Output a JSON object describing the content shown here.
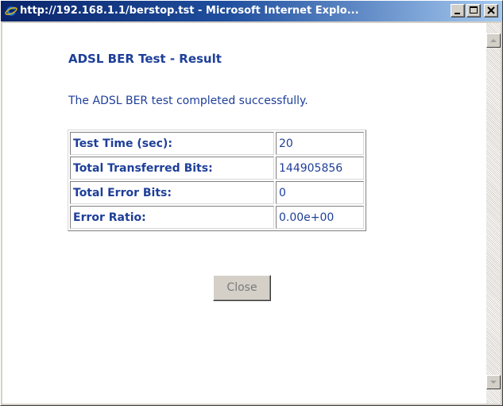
{
  "window": {
    "title": "http://192.168.1.1/berstop.tst - Microsoft Internet Explo...",
    "title_bar_color": "#0a246a",
    "app_icon": "internet-explorer-icon"
  },
  "page": {
    "heading": "ADSL BER Test - Result",
    "message": "The ADSL BER test completed successfully.",
    "text_color": "#1e3f99"
  },
  "results": {
    "rows": [
      {
        "label": "Test Time (sec):",
        "value": "20"
      },
      {
        "label": "Total Transferred Bits:",
        "value": "144905856"
      },
      {
        "label": "Total Error Bits:",
        "value": "0"
      },
      {
        "label": "Error Ratio:",
        "value": "0.00e+00"
      }
    ]
  },
  "buttons": {
    "close_label": "Close"
  }
}
